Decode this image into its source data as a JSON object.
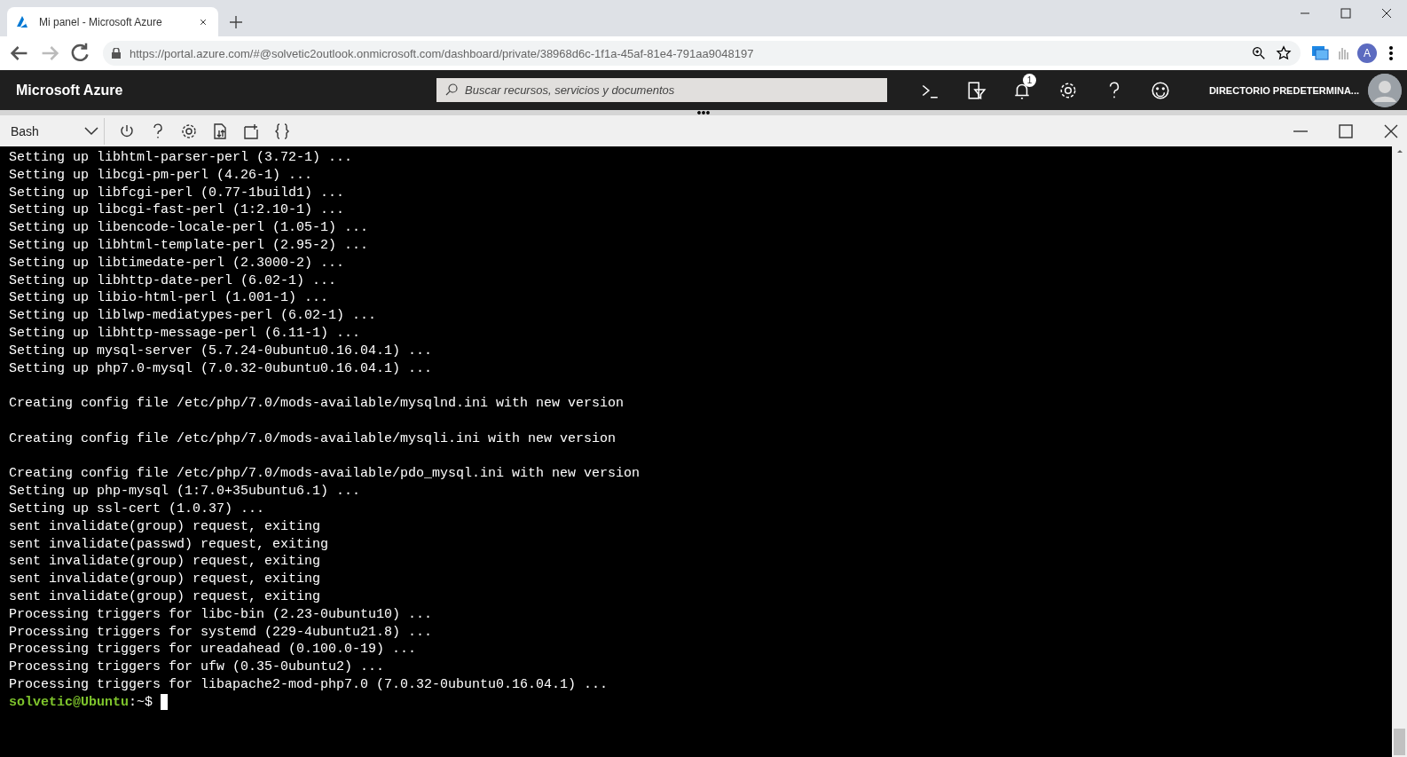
{
  "browser": {
    "tab": {
      "title": "Mi panel - Microsoft Azure"
    },
    "address": "https://portal.azure.com/#@solvetic2outlook.onmicrosoft.com/dashboard/private/38968d6c-1f1a-45af-81e4-791aa9048197",
    "profile_initial": "A"
  },
  "portal": {
    "brand": "Microsoft Azure",
    "search": {
      "placeholder": "Buscar recursos, servicios y documentos"
    },
    "notifications_count": "1",
    "directory": "DIRECTORIO PREDETERMINA..."
  },
  "shell": {
    "environment": "Bash",
    "blocks": [
      {
        "lines": [
          "Setting up libhtml-parser-perl (3.72-1) ...",
          "Setting up libcgi-pm-perl (4.26-1) ...",
          "Setting up libfcgi-perl (0.77-1build1) ...",
          "Setting up libcgi-fast-perl (1:2.10-1) ...",
          "Setting up libencode-locale-perl (1.05-1) ...",
          "Setting up libhtml-template-perl (2.95-2) ...",
          "Setting up libtimedate-perl (2.3000-2) ...",
          "Setting up libhttp-date-perl (6.02-1) ...",
          "Setting up libio-html-perl (1.001-1) ...",
          "Setting up liblwp-mediatypes-perl (6.02-1) ...",
          "Setting up libhttp-message-perl (6.11-1) ...",
          "Setting up mysql-server (5.7.24-0ubuntu0.16.04.1) ...",
          "Setting up php7.0-mysql (7.0.32-0ubuntu0.16.04.1) ..."
        ]
      },
      {
        "lines": [
          "Creating config file /etc/php/7.0/mods-available/mysqlnd.ini with new version"
        ]
      },
      {
        "lines": [
          "Creating config file /etc/php/7.0/mods-available/mysqli.ini with new version"
        ]
      },
      {
        "lines": [
          "Creating config file /etc/php/7.0/mods-available/pdo_mysql.ini with new version",
          "Setting up php-mysql (1:7.0+35ubuntu6.1) ...",
          "Setting up ssl-cert (1.0.37) ...",
          "sent invalidate(group) request, exiting",
          "sent invalidate(passwd) request, exiting",
          "sent invalidate(group) request, exiting",
          "sent invalidate(group) request, exiting",
          "sent invalidate(group) request, exiting",
          "Processing triggers for libc-bin (2.23-0ubuntu10) ...",
          "Processing triggers for systemd (229-4ubuntu21.8) ...",
          "Processing triggers for ureadahead (0.100.0-19) ...",
          "Processing triggers for ufw (0.35-0ubuntu2) ...",
          "Processing triggers for libapache2-mod-php7.0 (7.0.32-0ubuntu0.16.04.1) ..."
        ]
      }
    ],
    "prompt": {
      "user": "solvetic@Ubuntu",
      "path": ":~$"
    }
  }
}
